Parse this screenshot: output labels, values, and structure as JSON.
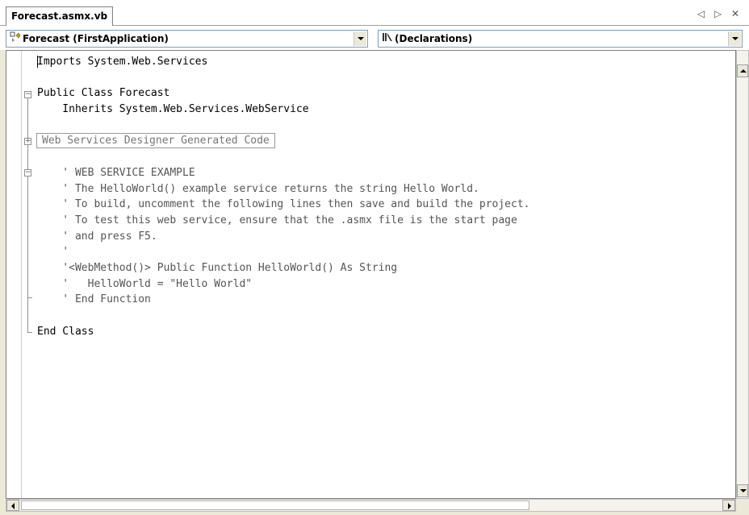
{
  "tab": {
    "title": "Forecast.asmx.vb",
    "nav": "◁ ▷ ✕"
  },
  "combos": {
    "left": {
      "value": "Forecast (FirstApplication)",
      "icon": "class-icon"
    },
    "right": {
      "value": "(Declarations)",
      "icon": "declarations-icon"
    }
  },
  "code_lines": [
    "Imports System.Web.Services",
    "",
    "Public Class Forecast",
    "    Inherits System.Web.Services.WebService",
    "",
    "Web Services Designer Generated Code",
    "",
    "    ' WEB SERVICE EXAMPLE",
    "    ' The HelloWorld() example service returns the string Hello World.",
    "    ' To build, uncomment the following lines then save and build the project.",
    "    ' To test this web service, ensure that the .asmx file is the start page",
    "    ' and press F5.",
    "    '",
    "    '<WebMethod()> Public Function HelloWorld() As String",
    "    '   HelloWorld = \"Hello World\"",
    "    ' End Function",
    "",
    "End Class"
  ]
}
